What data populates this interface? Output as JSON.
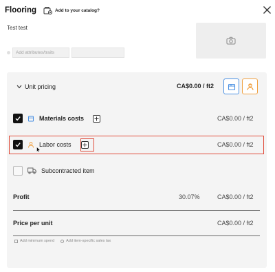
{
  "header": {
    "title": "Flooring",
    "catalog_label": "Add to your catalog?"
  },
  "item": {
    "name": "Test test",
    "attributes_placeholder": "Add attributes/traits"
  },
  "unit_pricing": {
    "label": "Unit pricing",
    "price": "CA$0.00",
    "unit": "/ ft2"
  },
  "rows": [
    {
      "label": "Materials costs",
      "value": "CA$0.00",
      "unit": "/ ft2",
      "checked": true
    },
    {
      "label": "Labor costs",
      "value": "CA$0.00",
      "unit": "/ ft2",
      "checked": true
    },
    {
      "label": "Subcontracted item",
      "checked": false
    }
  ],
  "profit": {
    "label": "Profit",
    "percent": "30.07",
    "percent_sign": "%",
    "value": "CA$0.00",
    "unit": "/ ft2"
  },
  "price_per_unit": {
    "label": "Price per unit",
    "value": "CA$0.00",
    "unit": "/ ft2"
  },
  "footer": {
    "min_spend": "Add minimum spend",
    "sales_tax": "Add item-specific sales tax"
  },
  "colors": {
    "materials_accent": "#4a90e2",
    "labor_accent": "#f0a040",
    "highlight": "#e04b3a"
  }
}
